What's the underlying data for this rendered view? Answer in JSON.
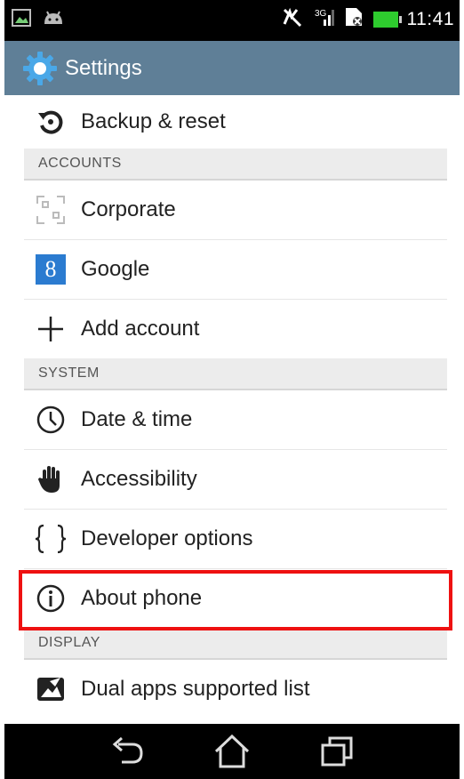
{
  "status_bar": {
    "time": "11:41",
    "icons": [
      "gallery-icon",
      "android-icon",
      "signal-off-icon",
      "signal-icon",
      "sim-icon",
      "battery-icon"
    ]
  },
  "action_bar": {
    "title": "Settings",
    "icon": "gear-icon"
  },
  "items": {
    "backup_reset": "Backup & reset",
    "corporate": "Corporate",
    "google": "Google",
    "google_badge": "8",
    "add_account": "Add account",
    "date_time": "Date & time",
    "accessibility": "Accessibility",
    "developer_options": "Developer options",
    "about_phone": "About phone",
    "dual_apps": "Dual apps supported list"
  },
  "sections": {
    "accounts": "ACCOUNTS",
    "system": "SYSTEM",
    "display": "DISPLAY"
  },
  "colors": {
    "action_bar": "#5f7f97",
    "highlight": "#ee1111",
    "section_bg": "#ececec"
  },
  "nav_bar": {
    "icons": [
      "back-icon",
      "home-icon",
      "recent-apps-icon"
    ]
  }
}
